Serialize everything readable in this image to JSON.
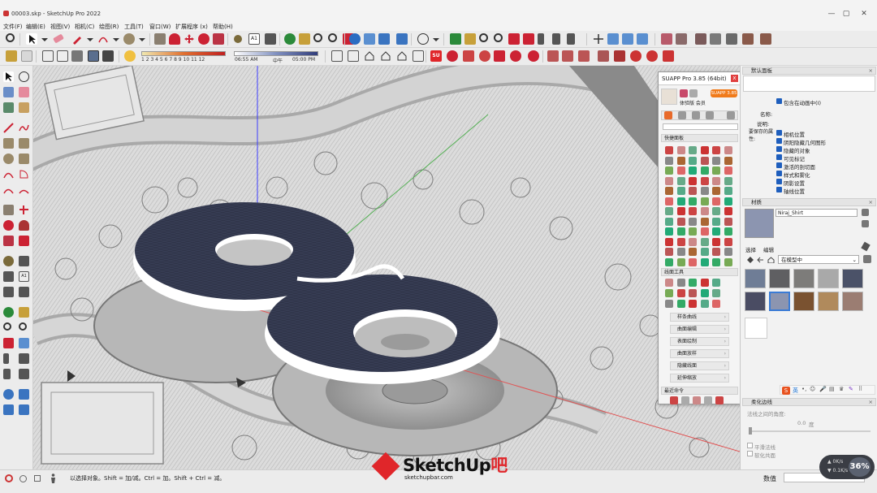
{
  "window": {
    "title": "00003.skp - SketchUp Pro 2022",
    "controls": [
      "—",
      "▢",
      "✕"
    ]
  },
  "menu": [
    "文件(F)",
    "编辑(E)",
    "视图(V)",
    "相机(C)",
    "绘图(R)",
    "工具(T)",
    "窗口(W)",
    "扩展程序 (x)",
    "帮助(H)"
  ],
  "toolbar2": {
    "ramp_ticks": "1 2 3 4 5 6 7 8 9 10 11 12",
    "time_start": "06:55 AM",
    "time_mid": "中午",
    "time_end": "05:00 PM"
  },
  "suapp": {
    "title": "SUAPP Pro 3.85 (64bit)",
    "close": "x",
    "user_label": "体验版 会员",
    "badge": "SUAPP 3.85",
    "quick_panel": "快捷面板",
    "line_tools": "线面工具",
    "categories": [
      "样条曲线",
      "曲面编辑",
      "表面绘制",
      "曲面放样",
      "隐藏线面",
      "延伸缩放"
    ],
    "recent": "最近命令"
  },
  "tray": {
    "default_panel": "默认面板",
    "include_anim": "包含在动画中(I)",
    "name_label": "名称:",
    "desc_label": "说明:",
    "scene_saves": "要保存的属性:",
    "properties": [
      "相机位置",
      "阴阳隐藏几何图形",
      "隐藏的对象",
      "可见标记",
      "激活的剖切面",
      "样式和雾化",
      "阴影设置",
      "轴线位置"
    ],
    "materials": "材质",
    "material_name": "Niraj_Shirt",
    "tab_select": "选择",
    "tab_edit": "编辑",
    "in_model": "在模型中",
    "swatch_colors": [
      "#6f7d96",
      "#5f5f62",
      "#7d7c7a",
      "#a9a9a9",
      "#4b5268",
      "#4a4c63",
      "#8c95b0",
      "#7a5230",
      "#b08a5c",
      "#9b7d72"
    ],
    "soften": "柔化边线",
    "angle_label": "法线之间的角度:",
    "angle_value": "0.0",
    "angle_unit": "度",
    "smooth_normals": "平滑法线",
    "soften_coplanar": "软化共面"
  },
  "status": {
    "hint": "以选择对象。Shift = 加/减。Ctrl = 加。Shift + Ctrl = 减。",
    "measure_label": "数值"
  },
  "watermark": {
    "brand_a": "SketchUp",
    "brand_b": "吧",
    "url": "sketchupbar.com"
  },
  "meter": {
    "percent": "36%",
    "up": "0K/s",
    "down": "0.1K/s"
  },
  "colors": {
    "accent": "#e0262a",
    "check": "#1e5ebd",
    "object": "#3c4258"
  }
}
